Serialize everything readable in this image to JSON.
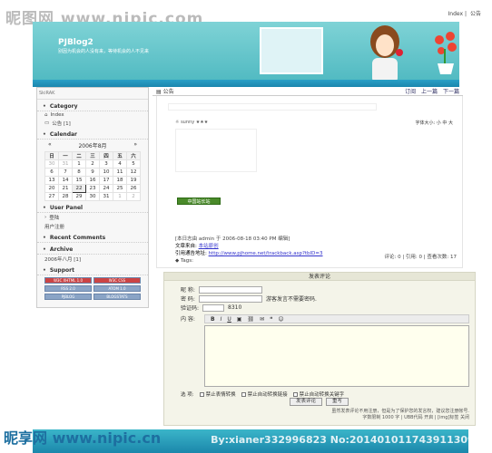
{
  "watermark_top": "昵图网 www.nipic.com",
  "watermark_bottom": "昵享网 www.nipic.cn",
  "watermark_bottom_right": "By:xianer332996823 No:20140101174391130973",
  "top_links": [
    "Index",
    "公告"
  ],
  "blog": {
    "title": "PJBlog2",
    "slogan": "别因为机会的人没有来，等待机会的人不见来"
  },
  "sidebar": {
    "header": "SkiRAK",
    "category": {
      "title": "Category",
      "items": [
        "Index",
        "公告 [1]"
      ]
    },
    "calendar": {
      "title": "Calendar",
      "month": "2006年8月",
      "prev": "«",
      "next": "»",
      "weekdays": [
        "日",
        "一",
        "二",
        "三",
        "四",
        "五",
        "六"
      ],
      "rows": [
        [
          "30",
          "31",
          "1",
          "2",
          "3",
          "4",
          "5"
        ],
        [
          "6",
          "7",
          "8",
          "9",
          "10",
          "11",
          "12"
        ],
        [
          "13",
          "14",
          "15",
          "16",
          "17",
          "18",
          "19"
        ],
        [
          "20",
          "21",
          "22",
          "23",
          "24",
          "25",
          "26"
        ],
        [
          "27",
          "28",
          "29",
          "30",
          "31",
          "1",
          "2"
        ]
      ]
    },
    "user_panel": {
      "title": "User Panel",
      "items": [
        "登陆",
        "用户注册"
      ]
    },
    "recent_comments": {
      "title": "Recent Comments"
    },
    "archive": {
      "title": "Archive",
      "items": [
        "2006年八月 [1]"
      ]
    },
    "support": {
      "title": "Support",
      "badges": [
        "W3C XHTML 1.0",
        "W3C CSS",
        "RSS 2.0",
        "ATOM 1.0",
        "PJBLOG",
        "BLOGSTATS"
      ]
    }
  },
  "main": {
    "crumb": "公告",
    "nav": [
      "订阅",
      "上一篇",
      "下一篇"
    ],
    "post": {
      "author_line": "sunny",
      "font_size": "字体大小: 小 中 大",
      "badge": "中国站长站",
      "meta_line1": "[本日志由 admin 于 2006-08-18 03:40 PM 编辑]",
      "meta_line2_label": "文章来自:",
      "meta_line2_value": "本站原创",
      "meta_line3_label": "引用通告地址:",
      "meta_line3_value": "http://www.pjhome.net/trackback.asp?tbID=3",
      "meta_line4": "Tags:",
      "footer": "评论: 0 | 引用: 0 | 查看次数: 17"
    }
  },
  "form": {
    "title": "发表评论",
    "name_label": "昵 称:",
    "password_label": "密 码:",
    "password_hint": "游客发言不需要密码.",
    "captcha_label": "验证码:",
    "captcha_value": "8310",
    "content_label": "内 容:",
    "toolbar": [
      "B",
      "I",
      "U"
    ],
    "options_label": "选 项:",
    "options": [
      "禁止表情转换",
      "禁止自动转换链接",
      "禁止自动转换关键字"
    ],
    "submit": "发表评论",
    "reset": "重写",
    "note_line1": "虽然发表评论不用注册，但是为了保护您的发言权，建议您注册帐号.",
    "note_line2": "字数限制 1000 字 | UBB代码 开启 | [img]标签 关闭"
  }
}
